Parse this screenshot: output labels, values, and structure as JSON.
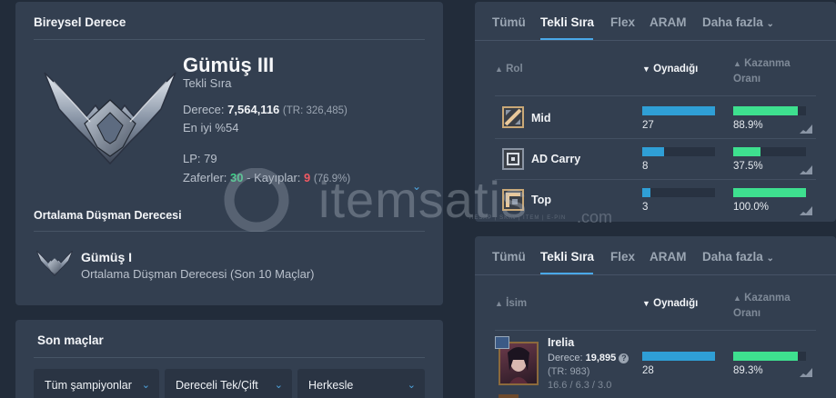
{
  "rank": {
    "title": "Bireysel Derece",
    "tier": "Gümüş III",
    "queue": "Tekli Sıra",
    "ladder_label": "Derece:",
    "ladder_value": "7,564,116",
    "ladder_tr": "(TR: 326,485)",
    "top_percent": "En iyi %54",
    "lp": "LP: 79",
    "wins_label": "Zaferler:",
    "wins": "30",
    "sep": "-",
    "losses_label": "Kayıplar:",
    "losses": "9",
    "winrate": "(76.9%)",
    "avg_title": "Ortalama Düşman Derecesi",
    "avg_tier": "Gümüş I",
    "avg_desc": "Ortalama Düşman Derecesi (Son 10 Maçlar)"
  },
  "matches": {
    "title": "Son maçlar",
    "filters": [
      "Tüm şampiyonlar",
      "Dereceli Tek/Çift",
      "Herkesle"
    ]
  },
  "roles_panel": {
    "tabs": [
      "Tümü",
      "Tekli Sıra",
      "Flex",
      "ARAM",
      "Daha fazla"
    ],
    "active_tab": "Tekli Sıra",
    "col_role": "Rol",
    "col_played": "Oynadığı",
    "col_winrate_1": "Kazanma",
    "col_winrate_2": "Oranı",
    "rows": [
      {
        "name": "Mid",
        "played": "27",
        "played_frac": 1.0,
        "winrate": "88.9%",
        "winrate_frac": 0.889
      },
      {
        "name": "AD Carry",
        "played": "8",
        "played_frac": 0.296,
        "winrate": "37.5%",
        "winrate_frac": 0.375
      },
      {
        "name": "Top",
        "played": "3",
        "played_frac": 0.111,
        "winrate": "100.0%",
        "winrate_frac": 1.0
      }
    ]
  },
  "champs_panel": {
    "tabs": [
      "Tümü",
      "Tekli Sıra",
      "Flex",
      "ARAM",
      "Daha fazla"
    ],
    "active_tab": "Tekli Sıra",
    "col_name": "İsim",
    "col_played": "Oynadığı",
    "col_winrate_1": "Kazanma",
    "col_winrate_2": "Oranı",
    "rows": [
      {
        "name": "Irelia",
        "rank_label": "Derece:",
        "rank_value": "19,895",
        "rank_tr": "(TR: 983)",
        "kda": "16.6 / 6.3 / 3.0",
        "played": "28",
        "played_frac": 1.0,
        "winrate": "89.3%",
        "winrate_frac": 0.893
      }
    ]
  },
  "watermark": {
    "brand": "itemsatis",
    "tagline": "HESAP | SKIN | ITEM | E-PIN",
    "suffix": ".com"
  },
  "colors": {
    "accent": "#4aa8e8",
    "played_bar": "#2f9fd6",
    "winrate_bar": "#3ee08f",
    "win": "#3fd68a",
    "loss": "#f05a63"
  }
}
